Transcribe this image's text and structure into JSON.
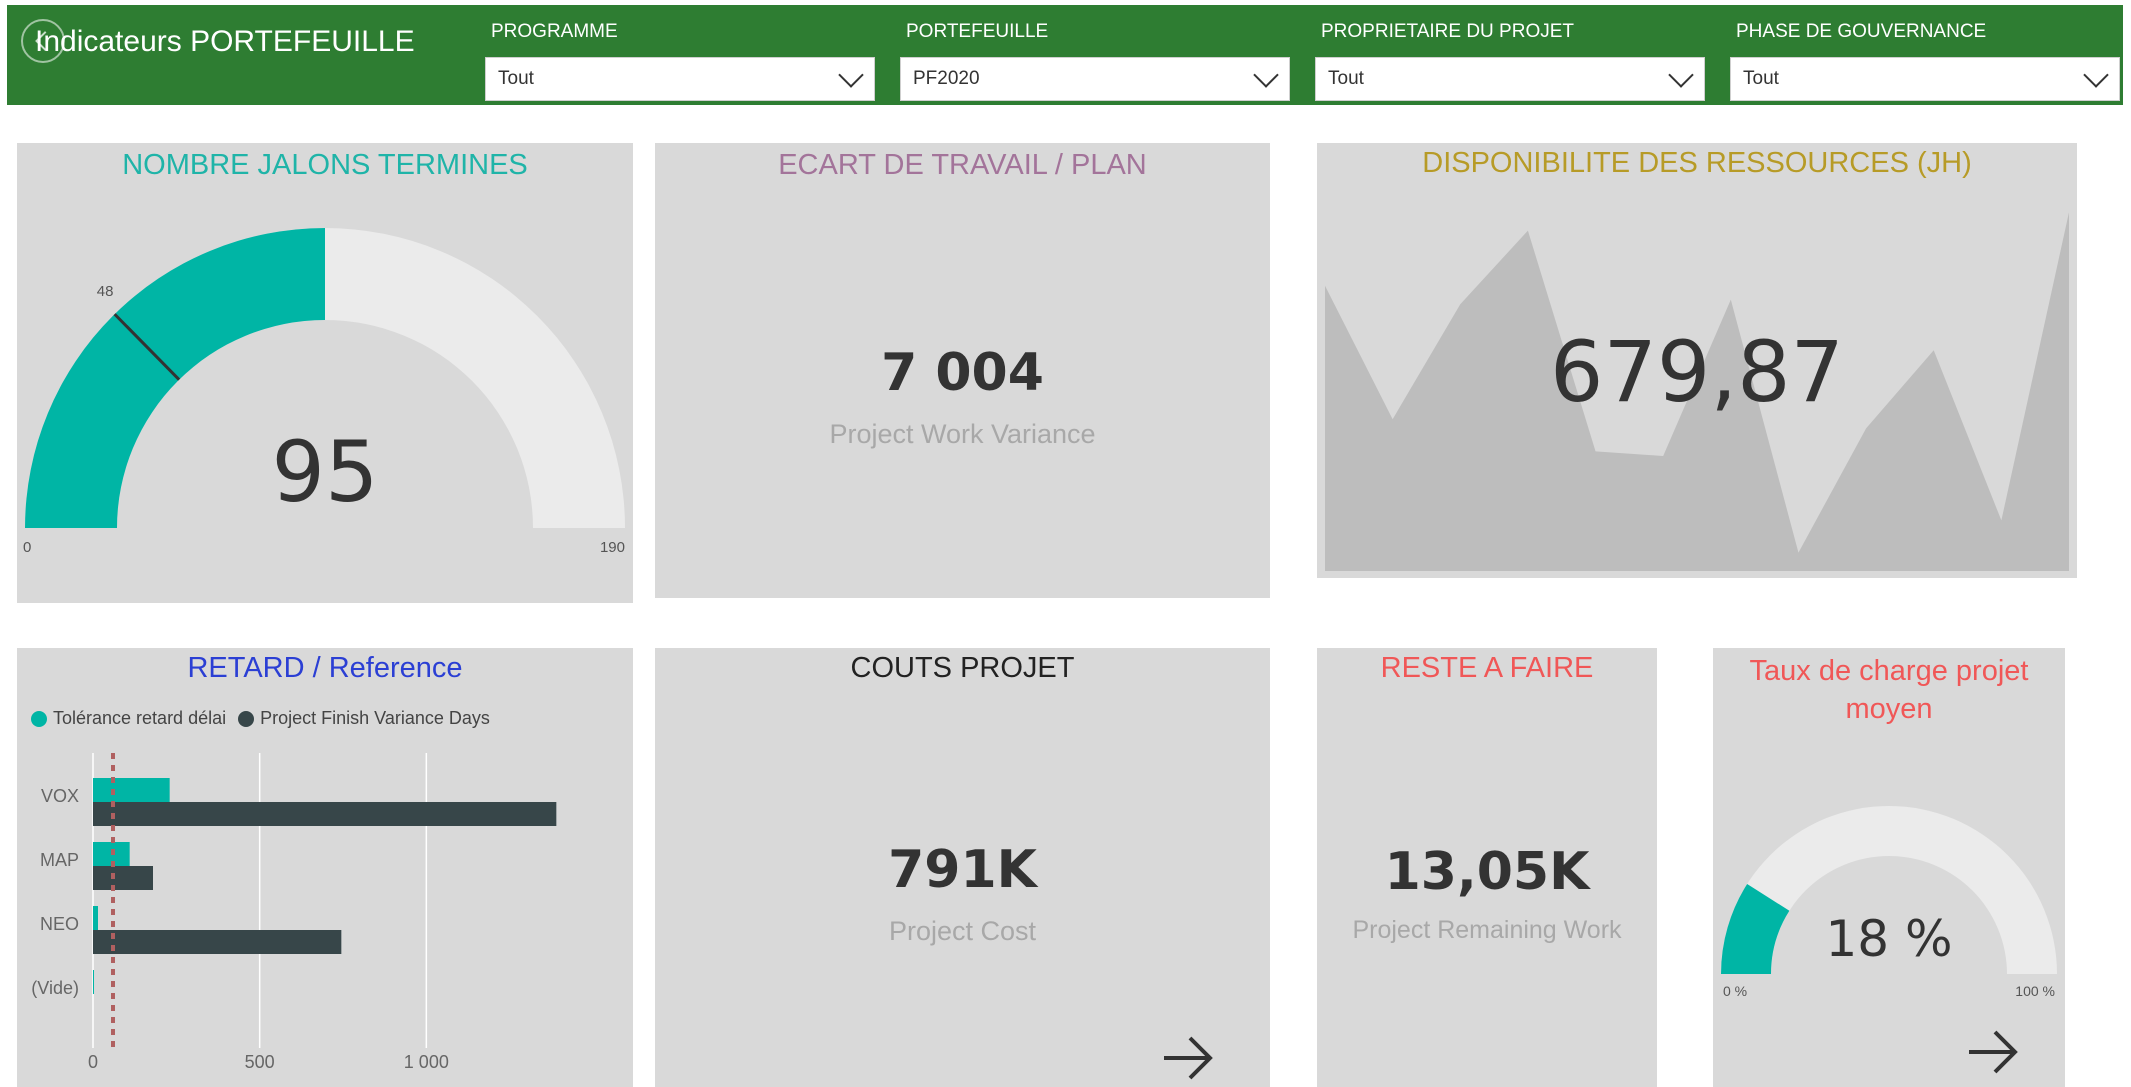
{
  "header": {
    "title": "Indicateurs PORTEFEUILLE",
    "slicers": [
      {
        "label": "PROGRAMME",
        "value": "Tout"
      },
      {
        "label": "PORTEFEUILLE",
        "value": "PF2020"
      },
      {
        "label": "PROPRIETAIRE DU PROJET",
        "value": "Tout"
      },
      {
        "label": "PHASE DE GOUVERNANCE",
        "value": "Tout"
      }
    ]
  },
  "colors": {
    "header_bg": "#2e7d32",
    "teal": "#00b5a5",
    "dark_bar": "#374649",
    "gauge_track": "#ebebeb",
    "card_bg": "#d9d9d9"
  },
  "cards": {
    "jalons": {
      "title": "NOMBRE JALONS TERMINES",
      "value": "95",
      "min_label": "0",
      "max_label": "190",
      "target_label": "48",
      "title_color": "#1fb4a8"
    },
    "ecart": {
      "title": "ECART DE TRAVAIL / PLAN",
      "value": "7 004",
      "subtitle": "Project Work Variance",
      "title_color": "#a3749a"
    },
    "dispo": {
      "title": "DISPONIBILITE DES RESSOURCES (JH)",
      "value": "679,87",
      "title_color": "#b79b27"
    },
    "retard": {
      "title": "RETARD / Reference",
      "title_color": "#2b3fd4"
    },
    "couts": {
      "title": "COUTS PROJET",
      "value": "791K",
      "subtitle": "Project Cost",
      "title_color": "#222222"
    },
    "reste": {
      "title": "RESTE A FAIRE",
      "value": "13,05K",
      "subtitle": "Project Remaining Work",
      "title_color": "#f05757"
    },
    "taux": {
      "title_line1": "Taux de charge projet",
      "title_line2": "moyen",
      "value": "18 %",
      "min_label": "0 %",
      "max_label": "100 %",
      "title_color": "#f05757"
    }
  },
  "chart_data": [
    {
      "type": "gauge",
      "title": "NOMBRE JALONS TERMINES",
      "value": 95,
      "min": 0,
      "max": 190,
      "target": 48
    },
    {
      "type": "area",
      "title": "DISPONIBILITE DES RESSOURCES (JH)",
      "values": [
        620,
        330,
        580,
        740,
        260,
        250,
        590,
        40,
        310,
        480,
        110,
        780
      ]
    },
    {
      "type": "bar",
      "orientation": "horizontal",
      "title": "RETARD / Reference",
      "categories": [
        "VOX",
        "MAP",
        "NEO",
        "(Vide)"
      ],
      "series": [
        {
          "name": "Tolérance retard délai",
          "values": [
            230,
            110,
            15,
            3
          ],
          "color": "#00b5a5"
        },
        {
          "name": "Project Finish Variance Days",
          "values": [
            1390,
            180,
            745,
            0
          ],
          "color": "#374649"
        }
      ],
      "xlim": [
        0,
        1500
      ],
      "xticks": [
        0,
        500,
        1000
      ],
      "xtick_labels": [
        "0",
        "500",
        "1 000"
      ],
      "reference_line": 60
    },
    {
      "type": "gauge",
      "title": "Taux de charge projet moyen",
      "value": 18,
      "min": 0,
      "max": 100
    }
  ]
}
